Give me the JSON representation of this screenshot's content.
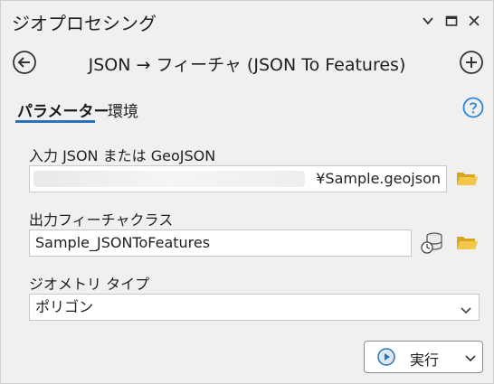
{
  "window": {
    "title": "ジオプロセシング"
  },
  "titlebar_icons": {
    "options": "chevron-down-icon",
    "maximize": "maximize-icon",
    "close": "close-icon"
  },
  "tool": {
    "title": "JSON → フィーチャ (JSON To Features)"
  },
  "tabs": [
    {
      "label": "パラメーター",
      "active": true
    },
    {
      "label": "環境",
      "active": false
    }
  ],
  "params": {
    "input_json": {
      "label": "入力 JSON または GeoJSON",
      "value": "¥Sample.geojson"
    },
    "output_fc": {
      "label": "出力フィーチャクラス",
      "value": "Sample_JSONToFeatures"
    },
    "geometry_type": {
      "label": "ジオメトリ タイプ",
      "selected": "ポリゴン"
    }
  },
  "run": {
    "label": "実行"
  },
  "colors": {
    "accent": "#2a73b8",
    "folder": "#e8b730",
    "help": "#2a86d6",
    "background": "#f0f0f0"
  }
}
